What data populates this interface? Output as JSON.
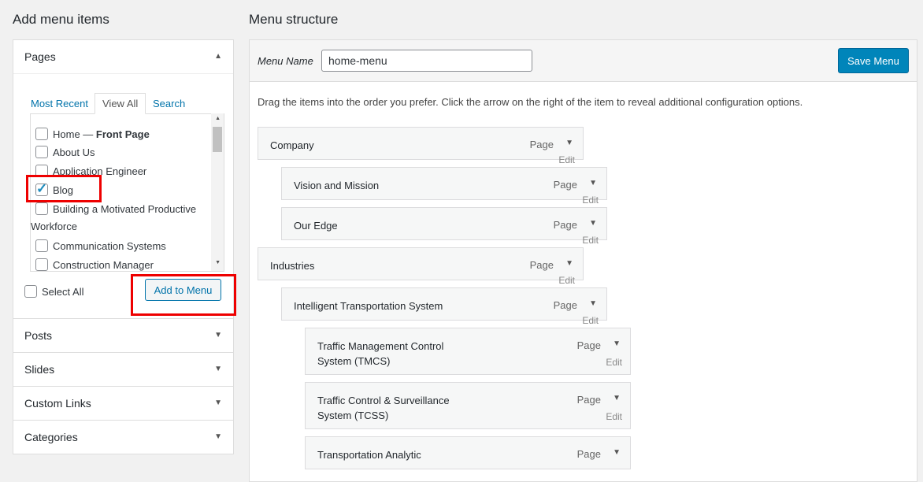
{
  "left": {
    "heading": "Add menu items",
    "pages": {
      "title": "Pages",
      "tabs": [
        "Most Recent",
        "View All",
        "Search"
      ],
      "items": [
        {
          "label": "Home — ",
          "bold": "Front Page",
          "checked": false
        },
        {
          "label": "About Us",
          "checked": false
        },
        {
          "label": "Application Engineer",
          "checked": false
        },
        {
          "label": "Blog",
          "checked": true
        },
        {
          "label": "Building a Motivated Productive",
          "label2": "Workforce",
          "checked": false
        },
        {
          "label": "Communication Systems",
          "checked": false
        },
        {
          "label": "Construction Manager",
          "checked": false
        }
      ],
      "select_all": "Select All",
      "add_button": "Add to Menu"
    },
    "sections": [
      "Posts",
      "Slides",
      "Custom Links",
      "Categories"
    ]
  },
  "right": {
    "heading": "Menu structure",
    "menu_name_label": "Menu Name",
    "menu_name_value": "home-menu",
    "save_button": "Save Menu",
    "instructions": "Drag the items into the order you prefer. Click the arrow on the right of the item to reveal additional configuration options.",
    "items": [
      {
        "title": "Company",
        "type": "Page",
        "depth": 0,
        "edit": "Edit"
      },
      {
        "title": "Vision and Mission",
        "type": "Page",
        "depth": 1,
        "edit": "Edit"
      },
      {
        "title": "Our Edge",
        "type": "Page",
        "depth": 1,
        "edit": "Edit"
      },
      {
        "title": "Industries",
        "type": "Page",
        "depth": 0,
        "edit": "Edit"
      },
      {
        "title": "Intelligent Transportation System",
        "type": "Page",
        "depth": 1,
        "edit": "Edit"
      },
      {
        "title": "Traffic Management Control",
        "title2": "System (TMCS)",
        "type": "Page",
        "depth": 2,
        "edit": "Edit"
      },
      {
        "title": "Traffic Control & Surveillance",
        "title2": "System (TCSS)",
        "type": "Page",
        "depth": 2,
        "edit": "Edit"
      },
      {
        "title": "Transportation Analytic",
        "type": "Page",
        "depth": 2,
        "edit": "Edit"
      }
    ]
  },
  "colors": {
    "primary": "#0085ba",
    "link": "#0073aa",
    "highlight": "#e00000"
  },
  "icons": {
    "expand": "triangle-down-icon",
    "collapse": "triangle-up-icon",
    "check": "checkmark-icon"
  }
}
